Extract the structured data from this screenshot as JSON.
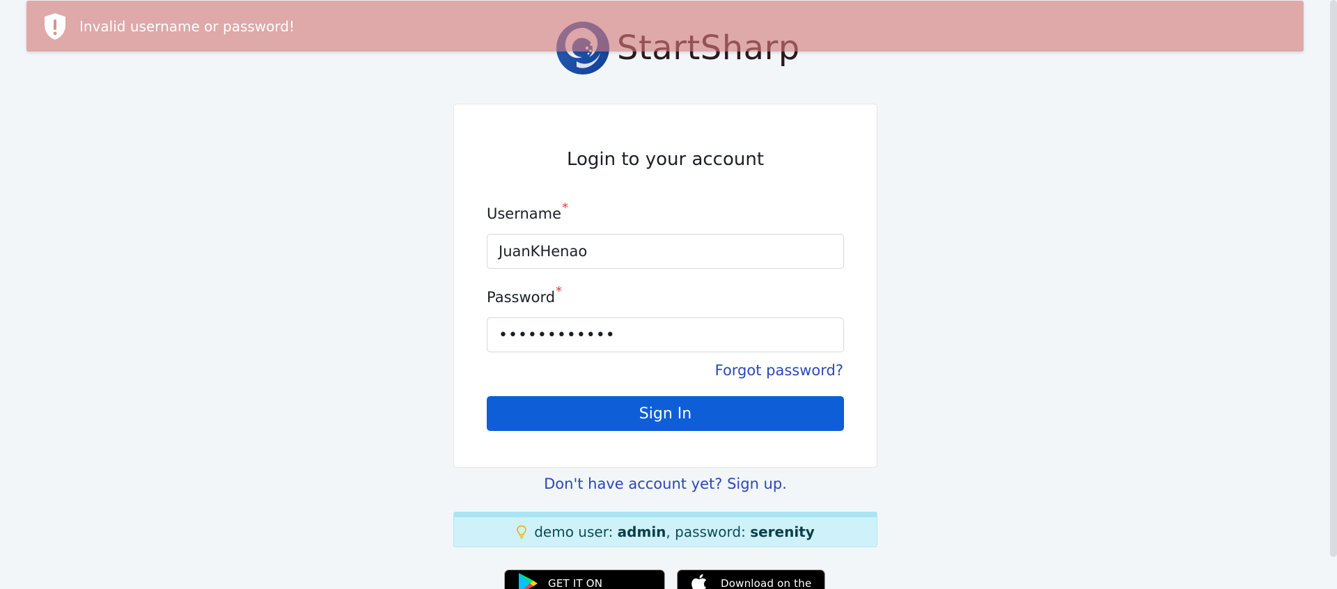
{
  "alert": {
    "message": "Invalid username or password!",
    "icon": "shield-exclamation-icon",
    "color": "#d47878"
  },
  "brand": {
    "name": "StartSharp",
    "logo_icon": "startsharp-logo-icon",
    "color": "#1a5fb4"
  },
  "login": {
    "title": "Login to your account",
    "username_label": "Username",
    "username_value": "JuanKHenao",
    "password_label": "Password",
    "password_value": "••••••••••••",
    "required_marker": "*",
    "forgot_password": "Forgot password?",
    "sign_in": "Sign In",
    "sign_in_color": "#0d5ed7"
  },
  "signup": {
    "text": "Don't have account yet? Sign up."
  },
  "demo": {
    "icon": "lightbulb-icon",
    "prefix": "demo user: ",
    "user": "admin",
    "middle": ", password: ",
    "password": "serenity"
  },
  "stores": {
    "google_label": "GET IT ON",
    "apple_label": "Download on the"
  }
}
